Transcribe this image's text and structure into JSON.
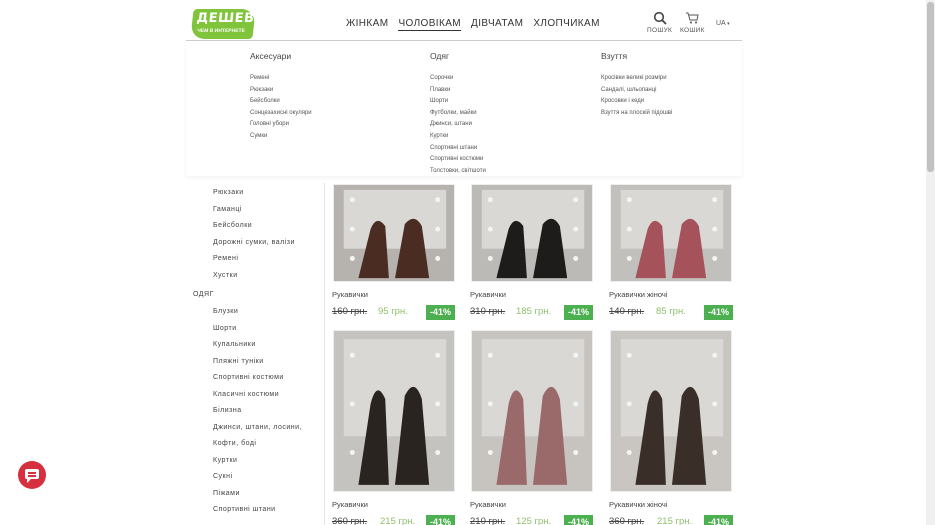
{
  "header": {
    "logo_line1": "ДЕШЕВЛЕ",
    "logo_line2": "ЧЕМ В ИНТЕРНЕТЕ",
    "nav": [
      {
        "label": "ЖІНКАМ"
      },
      {
        "label": "ЧОЛОВІКАМ"
      },
      {
        "label": "ДІВЧАТАМ"
      },
      {
        "label": "ХЛОПЧИКАМ"
      }
    ],
    "search_label": "ПОШУК",
    "cart_label": "КОШИК",
    "lang": "UA"
  },
  "mega_menu": {
    "columns": [
      {
        "title": "Аксесуари",
        "items": [
          "Ремені",
          "Рюкзаки",
          "Бейсболки",
          "Сонцезахисні окуляри",
          "Головні убори",
          "Сумки"
        ]
      },
      {
        "title": "Одяг",
        "items": [
          "Сорочки",
          "Плавки",
          "Шорти",
          "Футболки, майки",
          "Джинси, штани",
          "Куртки",
          "Спортивні штани",
          "Спортивні костюми",
          "Толстовки, світшоти"
        ]
      },
      {
        "title": "Взуття",
        "items": [
          "Кросівки великі розміри",
          "Сандалі, шльопанці",
          "Кросовки і кеди",
          "Взуття на плоскій підошві"
        ]
      }
    ]
  },
  "sidebar": {
    "group1": [
      "Рюкзаки",
      "Гаманці",
      "Бейсболки",
      "Дорожні сумки, валізи",
      "Ремені",
      "Хустки"
    ],
    "group2_title": "ОДЯГ",
    "group2": [
      "Блузки",
      "Шорти",
      "Купальники",
      "Пляжні туніки",
      "Спортивні костюми",
      "Класичні костюми",
      "Білизна",
      "Джинси, штани, лосини,",
      "Кофти, боді",
      "Куртки",
      "Сукні",
      "Піжами",
      "Спортивні штани"
    ]
  },
  "products": [
    {
      "name": "Рукавички",
      "old_price": "160 грн.",
      "new_price": "95 грн.",
      "discount": "-41%",
      "glove_color": "#4a2c22",
      "bg": "#b6b3ae"
    },
    {
      "name": "Рукавички",
      "old_price": "310 грн.",
      "new_price": "185 грн.",
      "discount": "-41%",
      "glove_color": "#1e1c1b",
      "bg": "#bcbab6"
    },
    {
      "name": "Рукавички жіночі",
      "old_price": "140 грн.",
      "new_price": "85 грн.",
      "discount": "-41%",
      "glove_color": "#a5525a",
      "bg": "#c2c0bc"
    },
    {
      "name": "Рукавички",
      "old_price": "360 грн.",
      "new_price": "215 грн.",
      "discount": "-41%",
      "glove_color": "#2a2421",
      "bg": "#c5c3bf"
    },
    {
      "name": "Рукавички",
      "old_price": "210 грн.",
      "new_price": "125 грн.",
      "discount": "-41%",
      "glove_color": "#9a6a6a",
      "bg": "#c7c4c0"
    },
    {
      "name": "Рукавички жіночі",
      "old_price": "360 грн.",
      "new_price": "215 грн.",
      "discount": "-41%",
      "glove_color": "#3a2e28",
      "bg": "#c9c6c2"
    }
  ],
  "colors": {
    "accent_green": "#4caf50",
    "new_price": "#8fbf6a",
    "chat": "#d62f3f",
    "logo": "#7fc43a"
  }
}
